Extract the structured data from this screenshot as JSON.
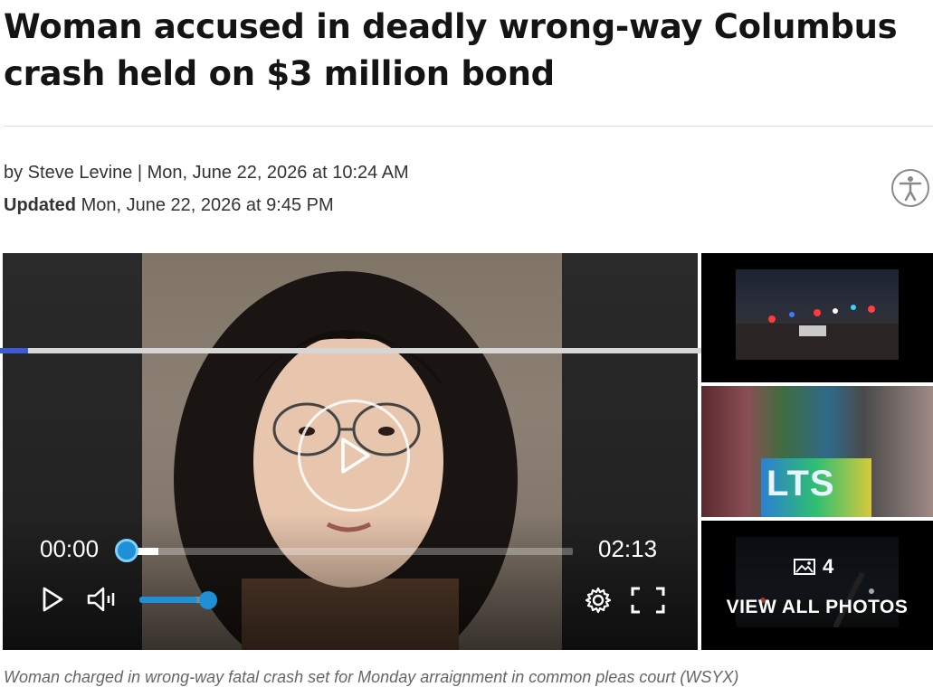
{
  "article": {
    "headline": "Woman accused in deadly wrong-way Columbus crash held on $3 million bond",
    "byline": "by Steve Levine | Mon, June 22, 2026 at 10:24 AM",
    "updated_label": "Updated",
    "updated_date": "Mon, June 22, 2026 at 9:45 PM"
  },
  "player": {
    "current_time": "00:00",
    "duration": "02:13",
    "page_progress": 0.03,
    "seek_buffered": 0.07,
    "volume": 0.8
  },
  "gallery": {
    "photo_count": "4",
    "view_all_label": "VIEW ALL PHOTOS",
    "thumb2_text": "LTS"
  },
  "caption": "Woman charged in wrong-way fatal crash set for Monday arraignment in common pleas court (WSYX)",
  "colors": {
    "accent_blue": "#1e90d6",
    "progress_blue": "#3d5bd9"
  },
  "icons": [
    "accessibility-icon",
    "play-icon",
    "volume-icon",
    "settings-icon",
    "fullscreen-icon",
    "image-icon"
  ]
}
